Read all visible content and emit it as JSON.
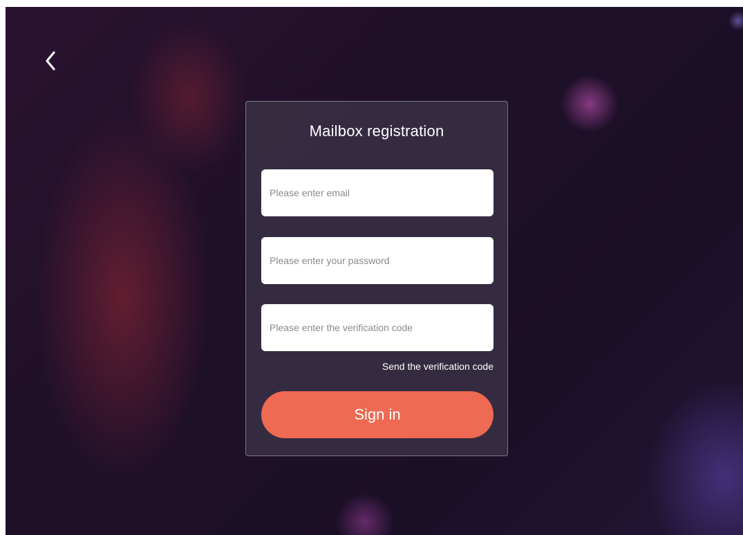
{
  "header": {
    "back_icon": "chevron-left-icon"
  },
  "form": {
    "title": "Mailbox registration",
    "email_placeholder": "Please enter email",
    "email_value": "",
    "password_placeholder": "Please enter your password",
    "password_value": "",
    "code_placeholder": "Please enter the verification code",
    "code_value": "",
    "send_code_label": "Send the verification code",
    "submit_label": "Sign in"
  },
  "colors": {
    "accent": "#ee6a52",
    "card_background": "#3a3246",
    "page_background": "#1f1029"
  }
}
